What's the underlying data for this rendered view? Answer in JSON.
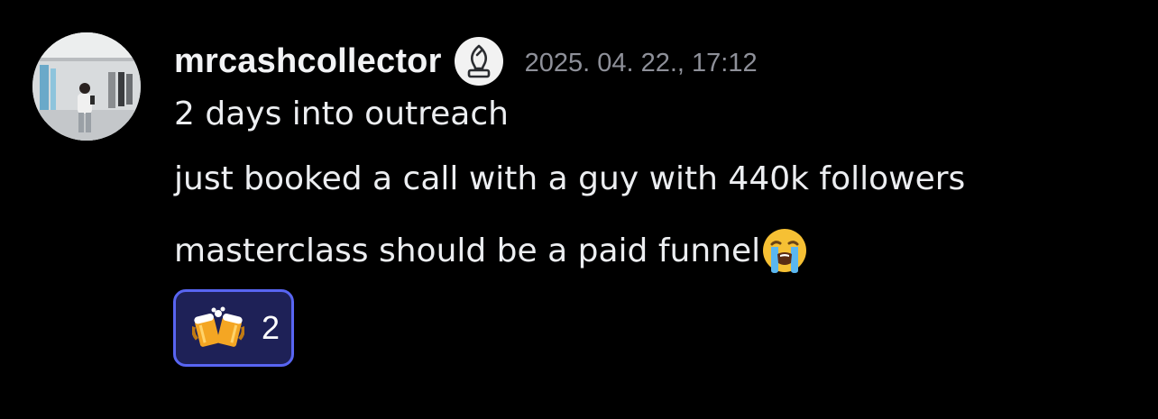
{
  "message": {
    "author": {
      "username": "mrcashcollector",
      "avatar": "avatar-photo",
      "badge_icon": "bishop-chess-icon"
    },
    "timestamp": "2025. 04. 22., 17:12",
    "lines": [
      "2 days into outreach",
      "just booked a call with a guy with 440k followers",
      "masterclass should be a paid funnel"
    ],
    "inline_emoji": "loudly-crying-face-icon",
    "reactions": [
      {
        "emoji": "clinking-beer-mugs-icon",
        "count": "2",
        "selected": true
      }
    ]
  },
  "colors": {
    "background": "#000000",
    "username": "#f2f3f5",
    "timestamp": "#8e9099",
    "reaction_border": "#5865f2",
    "reaction_bg": "#1e2157"
  }
}
